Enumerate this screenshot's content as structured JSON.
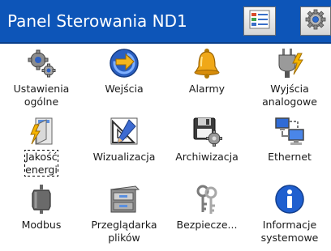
{
  "window": {
    "title": "Panel Sterowania ND1",
    "buttons": [
      {
        "icon": "list-view-icon"
      },
      {
        "icon": "gear-icon"
      }
    ]
  },
  "items": [
    {
      "label": "Ustawienia\nogólne",
      "icon": "settings-gears-icon"
    },
    {
      "label": "Wejścia",
      "icon": "inputs-arrow-icon"
    },
    {
      "label": "Alarmy",
      "icon": "bell-icon"
    },
    {
      "label": "Wyjścia\nanalogowe",
      "icon": "plug-lightning-icon"
    },
    {
      "label": "Jakość\nenergi",
      "icon": "energy-quality-icon",
      "focused": true
    },
    {
      "label": "Wizualizacja",
      "icon": "drafting-tools-icon"
    },
    {
      "label": "Archiwizacja",
      "icon": "archive-disk-icon"
    },
    {
      "label": "Ethernet",
      "icon": "network-computers-icon"
    },
    {
      "label": "Modbus",
      "icon": "modbus-cylinder-icon"
    },
    {
      "label": "Przeglądarka\nplików",
      "icon": "file-cabinet-icon"
    },
    {
      "label": "Bezpiecze...",
      "icon": "keys-icon"
    },
    {
      "label": "Informacje\nsystemowe",
      "icon": "info-icon"
    }
  ],
  "colors": {
    "titlebar": "#0d55b8",
    "title_text": "#ffffff"
  }
}
